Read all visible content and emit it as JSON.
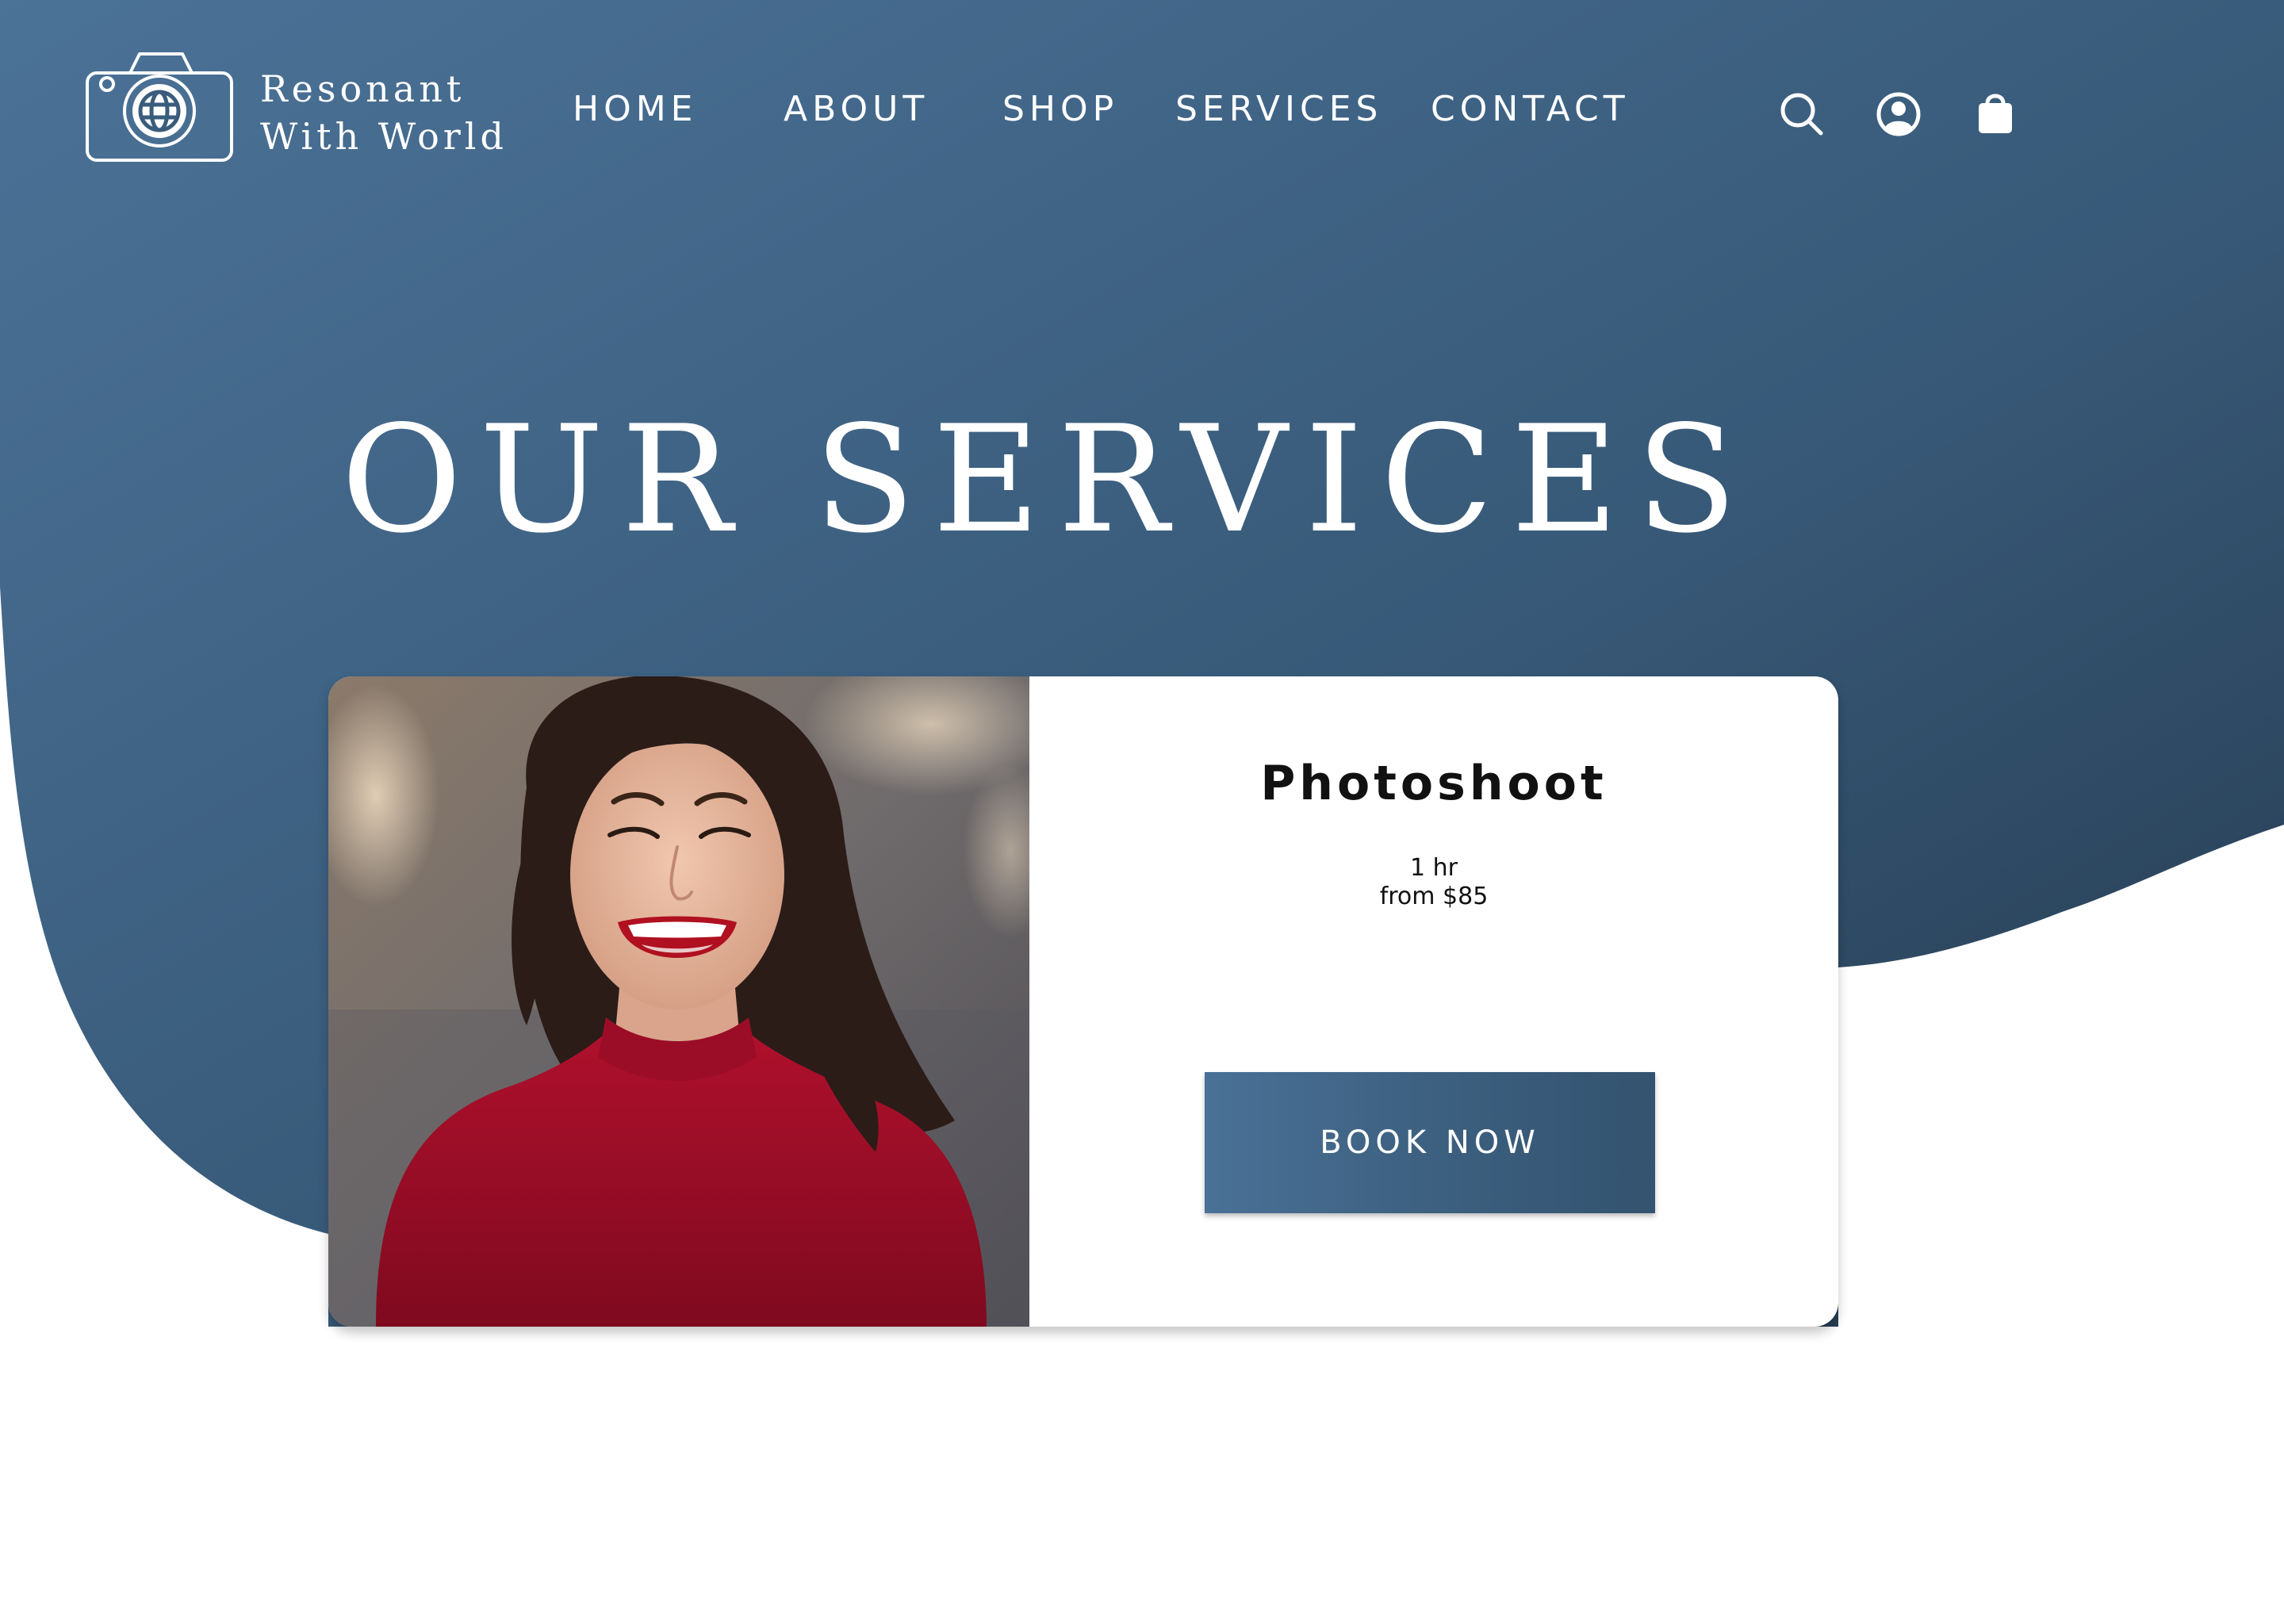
{
  "brand": {
    "line1": "Resonant",
    "line2": "With World",
    "logo_icon": "camera-globe-icon"
  },
  "nav": [
    {
      "label": "HOME"
    },
    {
      "label": "ABOUT"
    },
    {
      "label": "SHOP"
    },
    {
      "label": "SERVICES"
    },
    {
      "label": "CONTACT"
    }
  ],
  "header_icons": [
    "search-icon",
    "account-icon",
    "shopping-bag-icon"
  ],
  "page": {
    "title": "OUR SERVICES"
  },
  "service": {
    "name": "Photoshoot",
    "duration": "1 hr",
    "price": "from $85",
    "cta": "BOOK NOW",
    "image": "woman-in-red-sweater-smiling-photo"
  },
  "colors": {
    "hero_gradient_start": "#4a7196",
    "hero_gradient_end": "#26394d",
    "button": "#3f6384",
    "text_on_dark": "#ffffff",
    "text_dark": "#111111"
  }
}
